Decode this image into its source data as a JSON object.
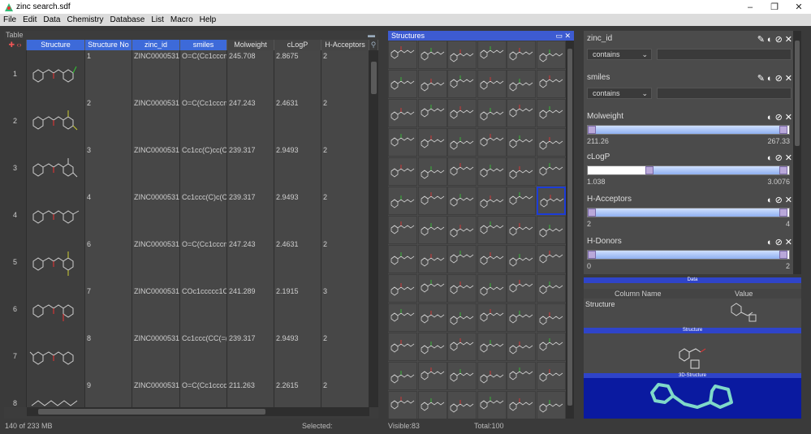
{
  "window": {
    "title": "zinc search.sdf",
    "controls": [
      "–",
      "❐",
      "✕"
    ]
  },
  "menu": [
    "File",
    "Edit",
    "Data",
    "Chemistry",
    "Database",
    "List",
    "Macro",
    "Help"
  ],
  "table": {
    "caption": "Table",
    "columns": [
      "Structure",
      "Structure No",
      "zinc_id",
      "smiles",
      "Molweight",
      "cLogP",
      "H-Acceptors"
    ],
    "rows": [
      {
        "rownum": "1",
        "no": "1",
        "zinc_id": "ZINC0000531",
        "smiles": "O=C(Cc1cccn",
        "mw": "245.708",
        "clogp": "2.8675",
        "hacc": "2"
      },
      {
        "rownum": "2",
        "no": "2",
        "zinc_id": "ZINC0000531",
        "smiles": "O=C(Cc1cccn",
        "mw": "247.243",
        "clogp": "2.4631",
        "hacc": "2"
      },
      {
        "rownum": "3",
        "no": "3",
        "zinc_id": "ZINC0000531",
        "smiles": "Cc1cc(C)cc(C",
        "mw": "239.317",
        "clogp": "2.9493",
        "hacc": "2"
      },
      {
        "rownum": "4",
        "no": "4",
        "zinc_id": "ZINC0000531",
        "smiles": "Cc1ccc(C)c(C",
        "mw": "239.317",
        "clogp": "2.9493",
        "hacc": "2"
      },
      {
        "rownum": "5",
        "no": "6",
        "zinc_id": "ZINC0000531",
        "smiles": "O=C(Cc1cccn",
        "mw": "247.243",
        "clogp": "2.4631",
        "hacc": "2"
      },
      {
        "rownum": "6",
        "no": "7",
        "zinc_id": "ZINC0000531",
        "smiles": "COc1ccccc1C",
        "mw": "241.289",
        "clogp": "2.1915",
        "hacc": "3"
      },
      {
        "rownum": "7",
        "no": "8",
        "zinc_id": "ZINC0000531",
        "smiles": "Cc1ccc(CC(=(",
        "mw": "239.317",
        "clogp": "2.9493",
        "hacc": "2"
      },
      {
        "rownum": "8",
        "no": "9",
        "zinc_id": "ZINC0000531",
        "smiles": "O=C(Cc1cccc",
        "mw": "211.263",
        "clogp": "2.2615",
        "hacc": "2"
      }
    ]
  },
  "structures_panel": {
    "title": "Structures"
  },
  "filters": {
    "zinc_id": {
      "label": "zinc_id",
      "mode": "contains",
      "value": ""
    },
    "smiles": {
      "label": "smiles",
      "mode": "contains",
      "value": ""
    },
    "molweight": {
      "label": "Molweight",
      "min_label": "211.26",
      "max_label": "267.33",
      "sel_low": 0.0,
      "sel_high": 1.0
    },
    "clogp": {
      "label": "cLogP",
      "min_label": "1.038",
      "max_label": "3.0076",
      "sel_low": 0.3,
      "sel_high": 1.0
    },
    "hacceptors": {
      "label": "H-Acceptors",
      "min_label": "2",
      "max_label": "4",
      "sel_low": 0.0,
      "sel_high": 1.0
    },
    "hdonors": {
      "label": "H-Donors",
      "min_label": "0",
      "max_label": "2",
      "sel_low": 0.0,
      "sel_high": 1.0
    }
  },
  "data_panel": {
    "title": "Data",
    "col_name": "Column Name",
    "col_value": "Value",
    "row_name": "Structure",
    "structure_label": "Structure",
    "view3d_label": "3D-Structure"
  },
  "status": {
    "memory": "140 of 233 MB",
    "selected": "Selected:",
    "visible": "Visible:83",
    "total": "Total:100"
  },
  "colors": {
    "accent": "#3d6ad9",
    "panel_bg": "#4a4a4a",
    "blue_bar": "#2f44c9"
  }
}
